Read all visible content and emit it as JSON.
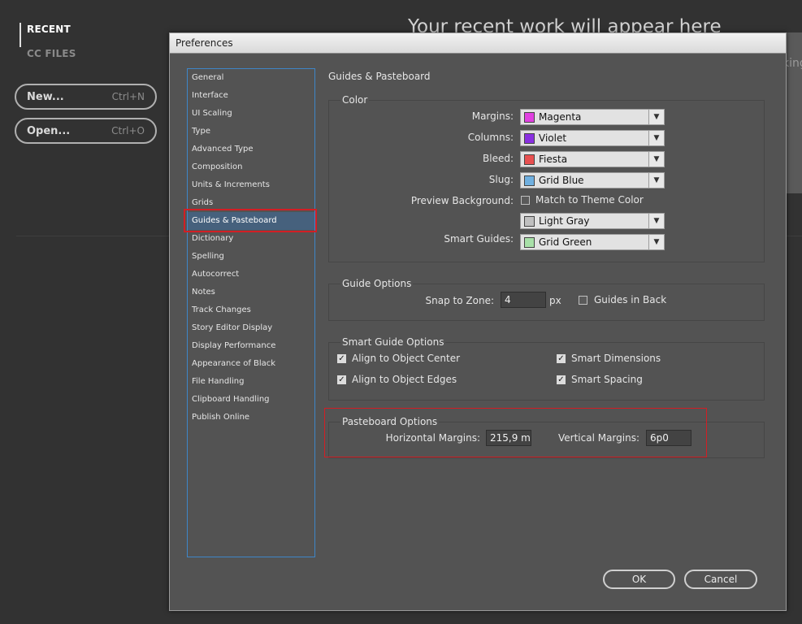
{
  "start_screen": {
    "nav": [
      {
        "label": "RECENT",
        "active": true
      },
      {
        "label": "CC FILES",
        "active": false
      }
    ],
    "buttons": [
      {
        "label": "New...",
        "shortcut": "Ctrl+N"
      },
      {
        "label": "Open...",
        "shortcut": "Ctrl+O"
      }
    ],
    "heading": "Your recent work will appear here",
    "side_text": "king"
  },
  "dialog": {
    "title": "Preferences",
    "categories": [
      "General",
      "Interface",
      "UI Scaling",
      "Type",
      "Advanced Type",
      "Composition",
      "Units & Increments",
      "Grids",
      "Guides & Pasteboard",
      "Dictionary",
      "Spelling",
      "Autocorrect",
      "Notes",
      "Track Changes",
      "Story Editor Display",
      "Display Performance",
      "Appearance of Black",
      "File Handling",
      "Clipboard Handling",
      "Publish Online"
    ],
    "selected_category": "Guides & Pasteboard",
    "page_title": "Guides & Pasteboard",
    "color": {
      "title": "Color",
      "margins": {
        "label": "Margins:",
        "value": "Magenta",
        "swatch": "#e040e0"
      },
      "columns": {
        "label": "Columns:",
        "value": "Violet",
        "swatch": "#8a30e0"
      },
      "bleed": {
        "label": "Bleed:",
        "value": "Fiesta",
        "swatch": "#e85050"
      },
      "slug": {
        "label": "Slug:",
        "value": "Grid Blue",
        "swatch": "#70b0e0"
      },
      "preview_bg": {
        "label": "Preview Background:",
        "checkbox_label": "Match to Theme Color",
        "checked": false,
        "value": "Light Gray",
        "swatch": "#c0c0c0"
      },
      "smart_guides": {
        "label": "Smart Guides:",
        "value": "Grid Green",
        "swatch": "#a8e0a8"
      }
    },
    "guide_options": {
      "title": "Guide Options",
      "snap_label": "Snap to Zone:",
      "snap_value": "4",
      "snap_unit": "px",
      "guides_in_back_label": "Guides in Back",
      "guides_in_back_checked": false
    },
    "smart_guide_options": {
      "title": "Smart Guide Options",
      "align_center": {
        "label": "Align to Object Center",
        "checked": true
      },
      "align_edges": {
        "label": "Align to Object Edges",
        "checked": true
      },
      "smart_dimensions": {
        "label": "Smart Dimensions",
        "checked": true
      },
      "smart_spacing": {
        "label": "Smart Spacing",
        "checked": true
      }
    },
    "pasteboard_options": {
      "title": "Pasteboard Options",
      "horizontal_label": "Horizontal Margins:",
      "horizontal_value": "215,9 mm",
      "vertical_label": "Vertical Margins:",
      "vertical_value": "6p0"
    },
    "ok_label": "OK",
    "cancel_label": "Cancel"
  },
  "colors": {
    "accent_border": "#3e86c8",
    "highlight_red": "#d21e24",
    "selected_bg": "#46617d"
  }
}
